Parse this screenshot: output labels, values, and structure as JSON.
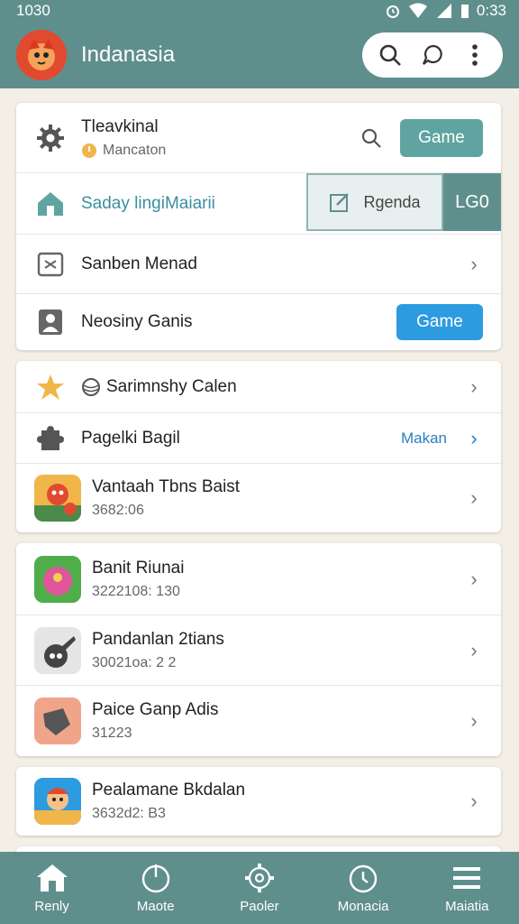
{
  "status_bar": {
    "time_left": "1030",
    "time_right": "0:33"
  },
  "app_bar": {
    "title": "Indanasia",
    "icons": [
      "search-icon",
      "chat-icon",
      "more-vert-icon"
    ]
  },
  "card1": {
    "row1": {
      "title": "Tleavkinal",
      "subtitle": "Mancaton",
      "button": "Game"
    },
    "row2": {
      "label": "Saday lingiMaiarii",
      "tab_active": "Rgenda",
      "tab_other": "LG0"
    },
    "row3": {
      "label": "Sanben Menad"
    },
    "row4": {
      "label": "Neosiny Ganis",
      "button": "Game"
    }
  },
  "card2": {
    "row1": {
      "label": "Sarimnshy Calen"
    },
    "row2": {
      "label": "Pagelki Bagil",
      "link": "Makan"
    },
    "row3": {
      "title": "Vantaah Tbns Baist",
      "sub": "3682:06"
    }
  },
  "card3": {
    "items": [
      {
        "title": "Banit Riunai",
        "sub": "3222108: 130"
      },
      {
        "title": "Pandanlan 2tians",
        "sub": "30021oa: 2 2"
      },
      {
        "title": "Paice Ganp Adis",
        "sub": "31223"
      }
    ]
  },
  "card4": {
    "title": "Pealamane Bkdalan",
    "sub": "3632d2: B3"
  },
  "bottom_nav": [
    "Renly",
    "Maote",
    "Paoler",
    "Monacia",
    "Maiatia"
  ],
  "colors": {
    "header": "#5f8f8d",
    "accent_teal": "#5fa4a0",
    "accent_blue": "#2d9be0"
  }
}
